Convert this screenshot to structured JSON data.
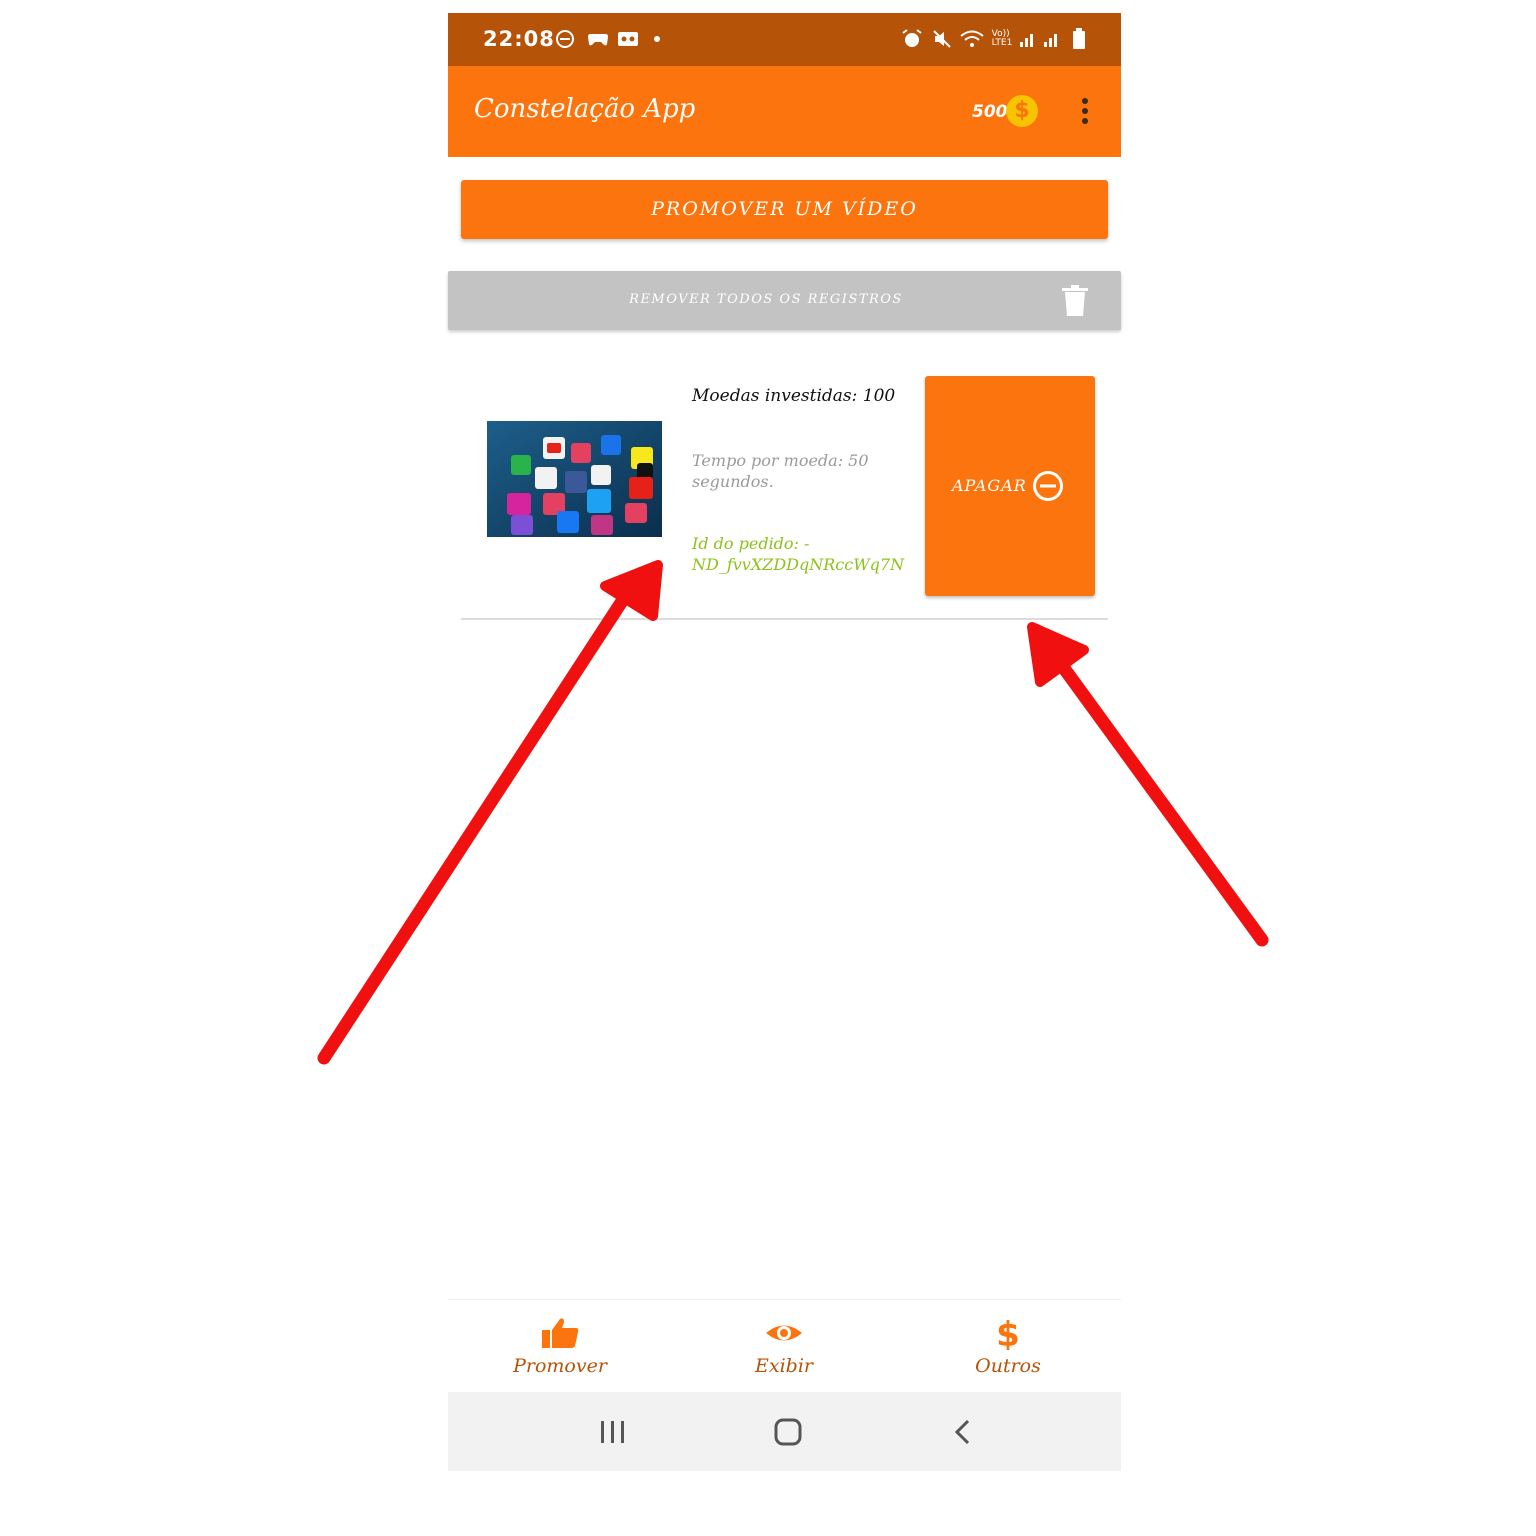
{
  "status_bar": {
    "time": "22:08",
    "signal_label": "Vo))\nLTE1"
  },
  "app_bar": {
    "title": "Constelação App",
    "coin_count": "500",
    "coin_symbol": "$"
  },
  "actions": {
    "promote_label": "PROMOVER UM VÍDEO",
    "remove_all_label": "REMOVER TODOS OS REGISTROS"
  },
  "records": [
    {
      "coins_invested": "Moedas investidas: 100",
      "time_per_coin": "Tempo por moeda: 50 segundos.",
      "order_id": "Id do pedido: -ND_fvvXZDDqNRccWq7N",
      "delete_label": "APAGAR"
    }
  ],
  "bottom_nav": {
    "items": [
      {
        "label": "Promover",
        "icon": "thumbs-up-icon"
      },
      {
        "label": "Exibir",
        "icon": "eye-icon"
      },
      {
        "label": "Outros",
        "icon": "dollar-icon"
      }
    ]
  },
  "colors": {
    "primary": "#fb740e",
    "status_bar": "#b55309",
    "disabled": "#c4c3c3",
    "id_green": "#8cc21a",
    "arrow_red": "#f01010"
  }
}
